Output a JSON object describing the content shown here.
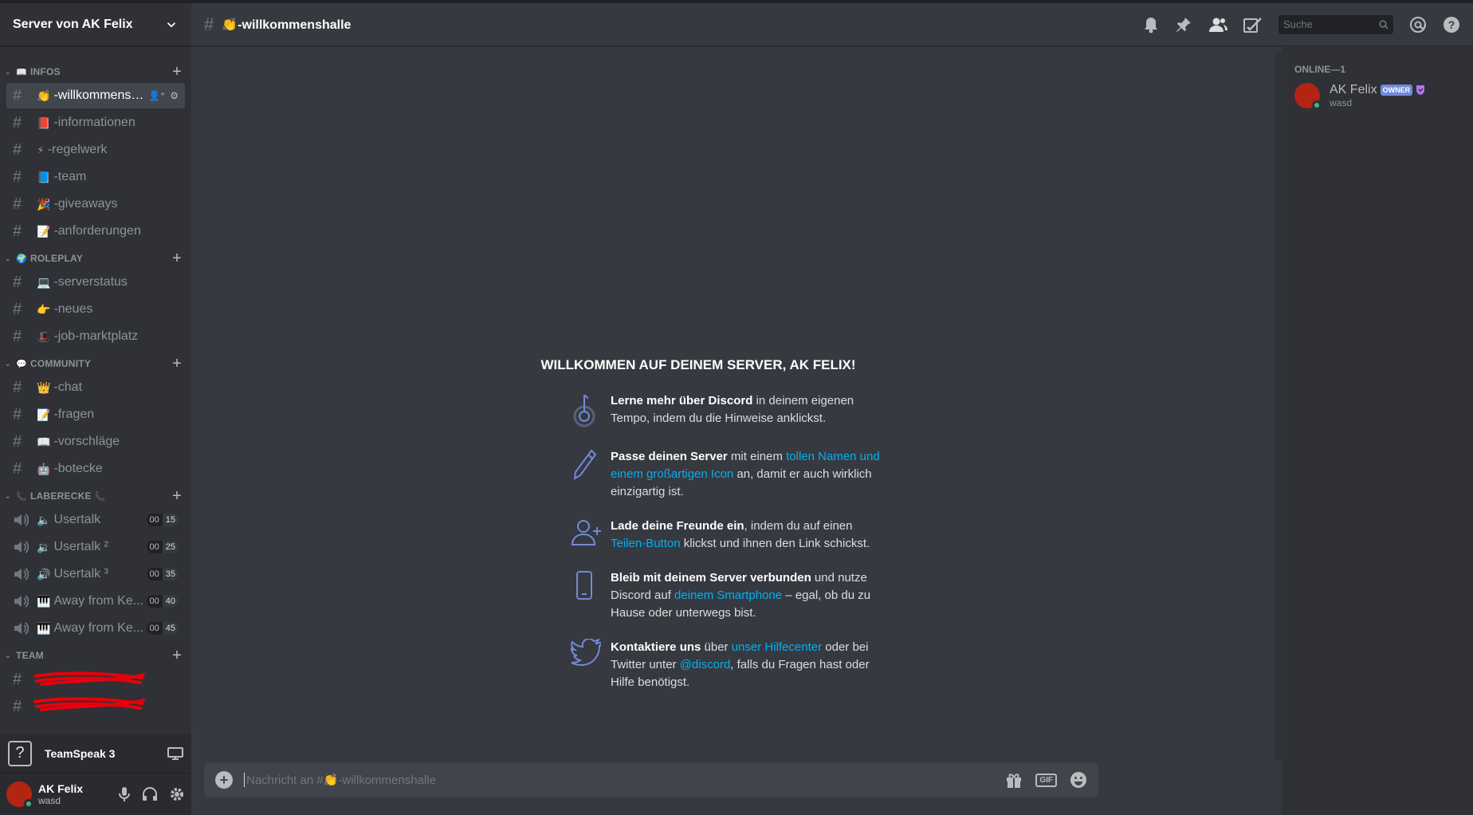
{
  "server": {
    "name": "Server von AK Felix"
  },
  "categories": [
    {
      "name": "INFOS",
      "emoji": "📖",
      "channels": [
        {
          "type": "text",
          "emoji": "👏",
          "name": "-willkommensh...",
          "active": true
        },
        {
          "type": "text",
          "emoji": "📕",
          "name": "-informationen"
        },
        {
          "type": "text",
          "emoji": "⚡",
          "name": "-regelwerk"
        },
        {
          "type": "text",
          "emoji": "📘",
          "name": "-team"
        },
        {
          "type": "text",
          "emoji": "🎉",
          "name": "-giveaways"
        },
        {
          "type": "text",
          "emoji": "📝",
          "name": "-anforderungen"
        }
      ]
    },
    {
      "name": "ROLEPLAY",
      "emoji": "🌍",
      "channels": [
        {
          "type": "text",
          "emoji": "💻",
          "name": "-serverstatus"
        },
        {
          "type": "text",
          "emoji": "👉",
          "name": "-neues"
        },
        {
          "type": "text",
          "emoji": "🎩",
          "name": "-job-marktplatz"
        }
      ]
    },
    {
      "name": "COMMUNITY",
      "emoji": "💬",
      "channels": [
        {
          "type": "text",
          "emoji": "👑",
          "name": "-chat"
        },
        {
          "type": "text",
          "emoji": "📝",
          "name": "-fragen"
        },
        {
          "type": "text",
          "emoji": "📖",
          "name": "-vorschläge"
        },
        {
          "type": "text",
          "emoji": "🤖",
          "name": "-botecke"
        }
      ]
    },
    {
      "name": "LABERECKE",
      "emoji": "📞",
      "emoji_after": "📞",
      "channels": [
        {
          "type": "voice",
          "emoji": "🔈",
          "name": "Usertalk",
          "count_a": "00",
          "count_b": "15"
        },
        {
          "type": "voice",
          "emoji": "🔉",
          "name": "Usertalk ²",
          "count_a": "00",
          "count_b": "25"
        },
        {
          "type": "voice",
          "emoji": "🔊",
          "name": "Usertalk ³",
          "count_a": "00",
          "count_b": "35"
        },
        {
          "type": "voice",
          "emoji": "🎹",
          "name": "Away from Ke...",
          "count_a": "00",
          "count_b": "40"
        },
        {
          "type": "voice",
          "emoji": "🎹",
          "name": "Away from Ke...",
          "count_a": "00",
          "count_b": "45"
        }
      ]
    },
    {
      "name": "TEAM",
      "channels": []
    }
  ],
  "teamspeak": {
    "label": "TeamSpeak 3",
    "icon_glyph": "?"
  },
  "user": {
    "name": "AK Felix",
    "tag": "wasd"
  },
  "topbar": {
    "channel_name": "👏-willkommenshalle",
    "search_placeholder": "Suche"
  },
  "welcome": {
    "title": "WILLKOMMEN AUF DEINEM SERVER, AK FELIX!",
    "tips": [
      {
        "icon": "learn-icon",
        "bold": "Lerne mehr über Discord",
        "t1": " in deinem eigenen Tempo, indem du die Hinweise anklickst.",
        "link": "",
        "t2": ""
      },
      {
        "icon": "pencil-icon",
        "bold": "Passe deinen Server",
        "t1": " mit einem ",
        "link": "tollen Namen und einem großartigen Icon",
        "t2": " an, damit er auch wirklich einzigartig ist."
      },
      {
        "icon": "add-friend-icon",
        "bold": "Lade deine Freunde ein",
        "t1": ", indem du auf einen ",
        "link": "Teilen-Button",
        "t2": " klickst und ihnen den Link schickst."
      },
      {
        "icon": "phone-icon",
        "bold": "Bleib mit deinem Server verbunden",
        "t1": " und nutze Discord auf ",
        "link": "deinem Smartphone",
        "t2": " – egal, ob du zu Hause oder unterwegs bist."
      },
      {
        "icon": "twitter-icon",
        "bold": "Kontaktiere uns",
        "t1": " über ",
        "link": "unser Hilfecenter",
        "t2": " oder bei Twitter unter ",
        "link2": "@discord",
        "t3": ", falls du Fragen hast oder Hilfe benötigst."
      }
    ]
  },
  "composer": {
    "placeholder": "Nachricht an #👏-willkommenshalle",
    "gif_label": "GIF"
  },
  "members": {
    "header": "ONLINE—1",
    "list": [
      {
        "name": "AK Felix",
        "badge": "OWNER",
        "status": "wasd"
      }
    ]
  },
  "colors": {
    "accent": "#7289da",
    "link": "#00b0f4",
    "online": "#43b581",
    "avatar": "#b42413"
  }
}
